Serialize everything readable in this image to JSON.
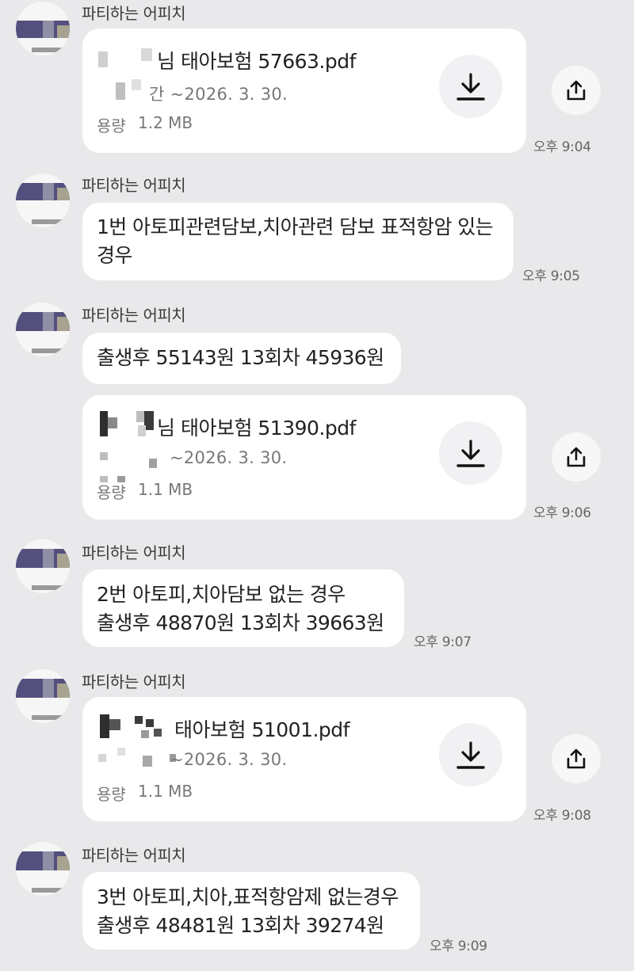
{
  "chat": {
    "messages": [
      {
        "sender": "파티하는 어피치",
        "type": "file",
        "file_name": "님 태아보험 57663.pdf",
        "file_period": "~2026. 3. 30.",
        "file_period_prefix": "간",
        "size_label": "용량",
        "size_value": "1.2 MB",
        "time": "오후 9:04"
      },
      {
        "sender": "파티하는 어피치",
        "type": "text",
        "lines": [
          "1번 아토피관련담보,치아관련 담보 표적항암 있는",
          "경우"
        ],
        "time": "오후 9:05"
      },
      {
        "sender": "파티하는 어피치",
        "type": "text",
        "lines": [
          "출생후 55143원 13회차 45936원"
        ],
        "time": ""
      },
      {
        "sender": "",
        "type": "file",
        "file_name": "님 태아보험 51390.pdf",
        "file_period": "~2026. 3. 30.",
        "size_label": "용량",
        "size_value": "1.1 MB",
        "time": "오후 9:06"
      },
      {
        "sender": "파티하는 어피치",
        "type": "text",
        "lines": [
          "2번 아토피,치아담보 없는 경우",
          "출생후 48870원 13회차 39663원"
        ],
        "time": "오후 9:07"
      },
      {
        "sender": "파티하는 어피치",
        "type": "file",
        "file_name": "태아보험 51001.pdf",
        "file_period": "~2026. 3. 30.",
        "size_label": "용량",
        "size_value": "1.1 MB",
        "time": "오후 9:08"
      },
      {
        "sender": "파티하는 어피치",
        "type": "text",
        "lines": [
          "3번 아토피,치아,표적항암제 없는경우",
          "출생후 48481원 13회차 39274원"
        ],
        "time": "오후 9:09"
      }
    ]
  },
  "icons": {
    "download": "download-icon",
    "share": "share-icon"
  },
  "colors": {
    "background": "#e9e9eb",
    "bubble": "#ffffff",
    "text": "#222222",
    "muted": "#777777"
  }
}
